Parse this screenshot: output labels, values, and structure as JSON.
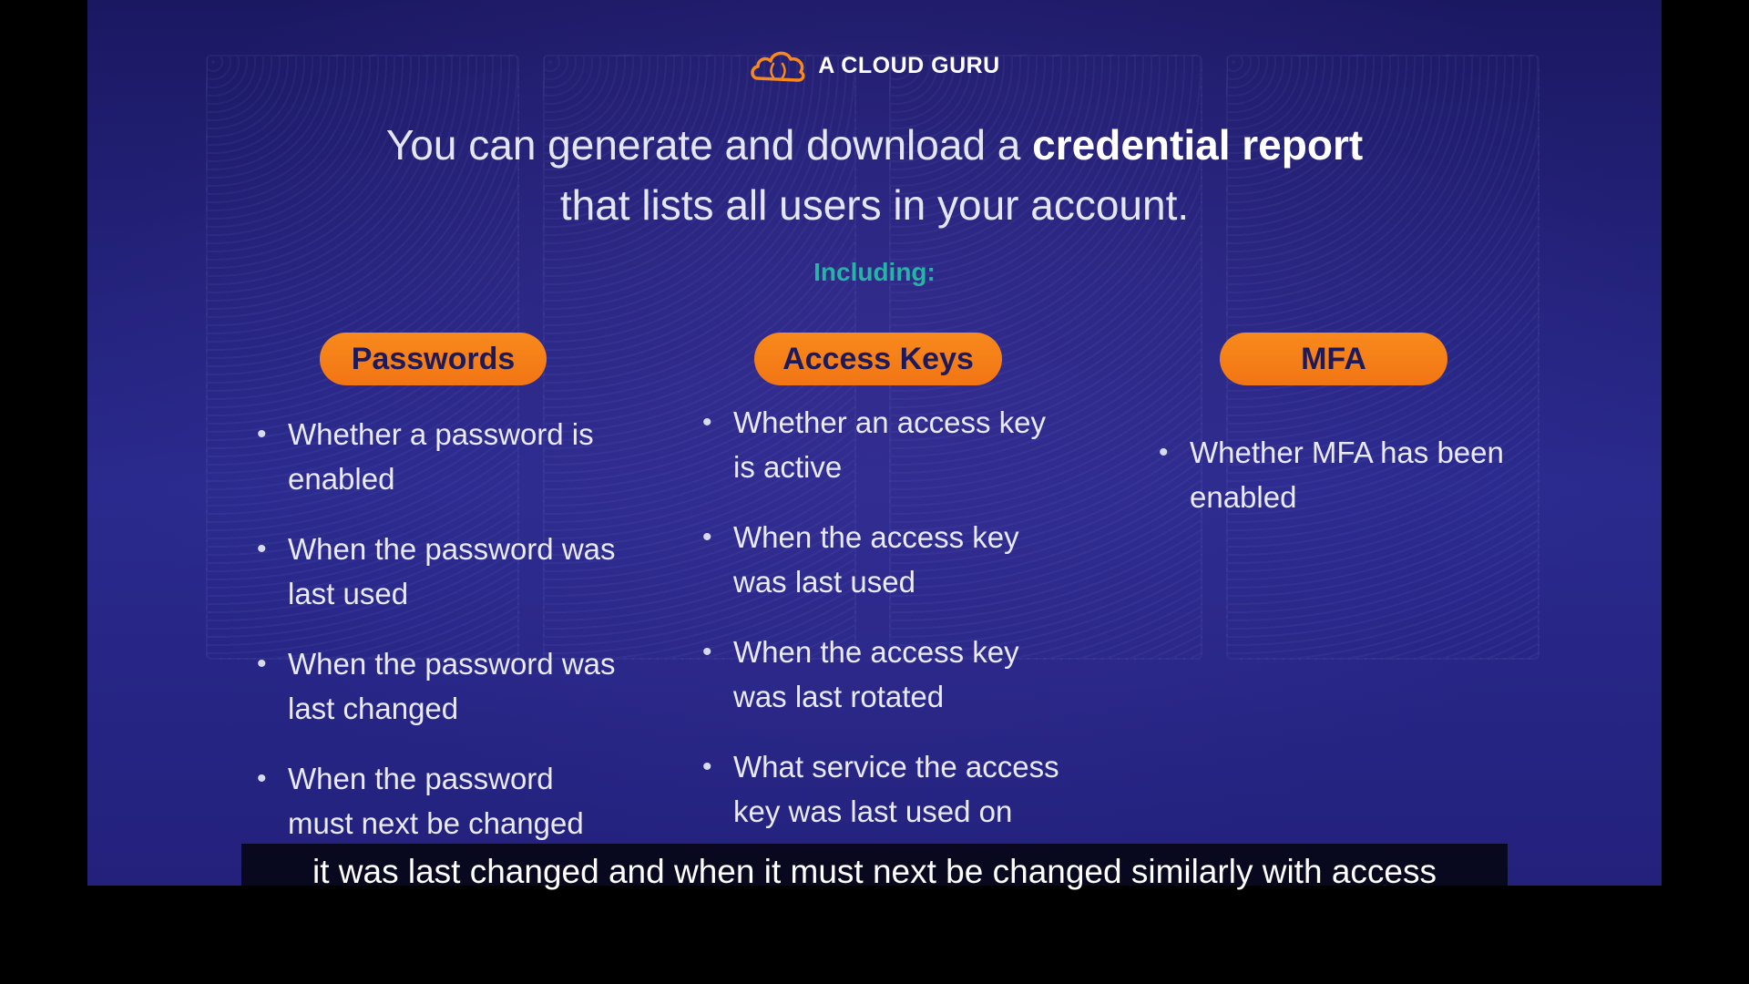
{
  "brand": {
    "name": "A CLOUD GURU",
    "icon": "cloud-logo-icon"
  },
  "headline": {
    "part1": "You can generate and download a ",
    "bold": "credential report",
    "line2": "that lists all users in your account."
  },
  "including_label": "Including:",
  "columns": [
    {
      "label": "Passwords",
      "items": [
        "Whether a password is enabled",
        "When the password was last used",
        "When the password was last changed",
        "When the password must next be changed"
      ]
    },
    {
      "label": "Access Keys",
      "items": [
        "Whether an access key is active",
        "When the access key was last used",
        "When the access key was last rotated",
        "What service the access key was last used on"
      ]
    },
    {
      "label": "MFA",
      "items": [
        "Whether MFA has been enabled"
      ]
    }
  ],
  "bullet_char": "•",
  "caption": "it was last changed and when it must next be changed similarly with access",
  "colors": {
    "accent_orange": "#f27514",
    "pill_text": "#1d1a5c",
    "including_teal": "#27b3a5",
    "background": "#2a2a8e"
  }
}
